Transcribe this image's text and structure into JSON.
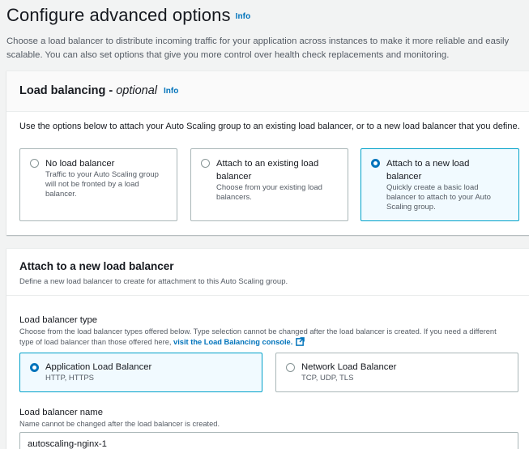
{
  "page": {
    "title": "Configure advanced options",
    "info": "Info",
    "description": "Choose a load balancer to distribute incoming traffic for your application across instances to make it more reliable and easily scalable. You can also set options that give you more control over health check replacements and monitoring."
  },
  "load_balancing": {
    "title": "Load balancing - ",
    "title_optional": "optional",
    "info": "Info",
    "description": "Use the options below to attach your Auto Scaling group to an existing load balancer, or to a new load balancer that you define.",
    "options": [
      {
        "label": "No load balancer",
        "description": "Traffic to your Auto Scaling group will not be fronted by a load balancer.",
        "selected": false
      },
      {
        "label": "Attach to an existing load balancer",
        "description": "Choose from your existing load balancers.",
        "selected": false
      },
      {
        "label": "Attach to a new load balancer",
        "description": "Quickly create a basic load balancer to attach to your Auto Scaling group.",
        "selected": true
      }
    ]
  },
  "new_lb": {
    "title": "Attach to a new load balancer",
    "description": "Define a new load balancer to create for attachment to this Auto Scaling group.",
    "type_label": "Load balancer type",
    "type_hint": "Choose from the load balancer types offered below. Type selection cannot be changed after the load balancer is created. If you need a different type of load balancer than those offered here, ",
    "type_hint_link": "visit the Load Balancing console.",
    "types": [
      {
        "label": "Application Load Balancer",
        "description": "HTTP, HTTPS",
        "selected": true
      },
      {
        "label": "Network Load Balancer",
        "description": "TCP, UDP, TLS",
        "selected": false
      }
    ],
    "name_label": "Load balancer name",
    "name_hint": "Name cannot be changed after the load balancer is created.",
    "name_value": "autoscaling-nginx-1"
  },
  "colors": {
    "link": "#0073bb",
    "selected_border": "#00a1c9",
    "selected_bg": "#f1faff",
    "page_bg": "#f2f3f3"
  }
}
